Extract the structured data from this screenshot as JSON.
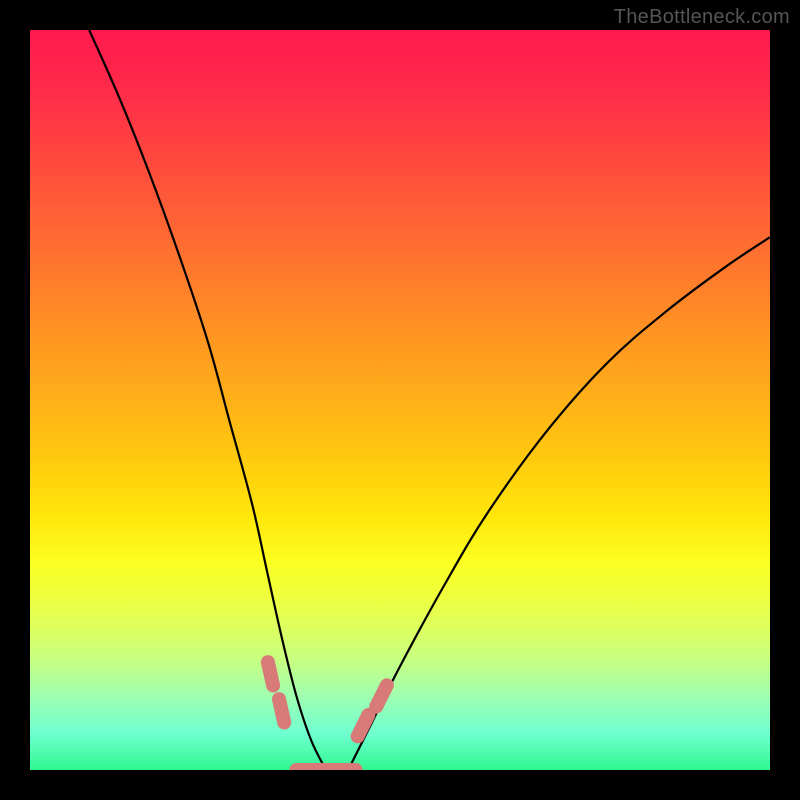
{
  "watermark": {
    "text": "TheBottleneck.com"
  },
  "colors": {
    "frame": "#000000",
    "curve": "#000000",
    "marker": "#d87a78",
    "gradient_top": "#ff1a4d",
    "gradient_bottom": "#30f890"
  },
  "chart_data": {
    "type": "line",
    "title": "",
    "xlabel": "",
    "ylabel": "",
    "xlim": [
      0,
      100
    ],
    "ylim": [
      0,
      100
    ],
    "notes": "Bottleneck-style V-curve over a vertical red→green gradient. Both curves descend to ~0 near x≈35–43; left branch falls steeply from top-left, right branch rises toward upper-right. Pink rounded markers sit on each curve near the trough and a short flat segment joins them at the bottom.",
    "series": [
      {
        "name": "left-branch",
        "x": [
          8,
          12,
          16,
          20,
          24,
          27,
          30,
          32,
          34,
          36,
          38,
          40
        ],
        "y": [
          100,
          91,
          81,
          70,
          58,
          47,
          36,
          27,
          18,
          10,
          4,
          0
        ]
      },
      {
        "name": "right-branch",
        "x": [
          43,
          46,
          50,
          56,
          62,
          70,
          78,
          86,
          94,
          100
        ],
        "y": [
          0,
          6,
          14,
          25,
          35,
          46,
          55,
          62,
          68,
          72
        ]
      }
    ],
    "flat_segment": {
      "x": [
        36,
        44
      ],
      "y": 0
    },
    "markers": [
      {
        "series": "left-branch",
        "x": 32.5,
        "y": 13
      },
      {
        "series": "left-branch",
        "x": 34.0,
        "y": 8
      },
      {
        "series": "right-branch",
        "x": 45.0,
        "y": 6
      },
      {
        "series": "right-branch",
        "x": 47.5,
        "y": 10
      }
    ]
  }
}
